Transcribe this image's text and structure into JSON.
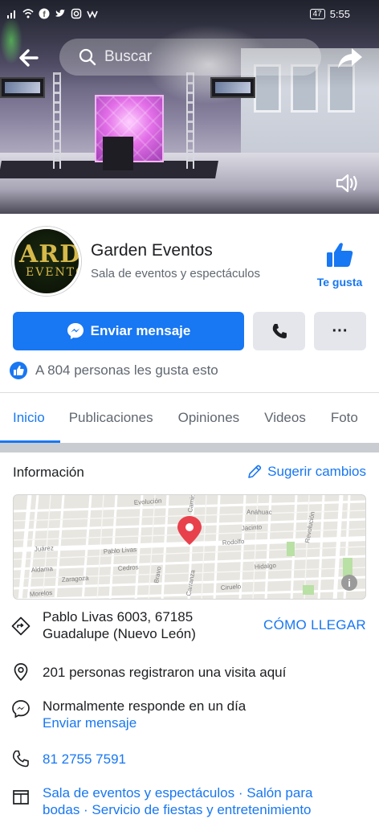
{
  "status_bar": {
    "battery": "47",
    "time": "5:55"
  },
  "search": {
    "placeholder": "Buscar"
  },
  "page": {
    "avatar_text_top": "ARDE",
    "avatar_text_bottom": "EVENTO",
    "name": "Garden Eventos",
    "category": "Sala de eventos y espectáculos",
    "like_label": "Te gusta"
  },
  "actions": {
    "message_label": "Enviar mensaje",
    "more_label": "···"
  },
  "likes_text": "A 804 personas les gusta esto",
  "tabs": [
    {
      "label": "Inicio"
    },
    {
      "label": "Publicaciones"
    },
    {
      "label": "Opiniones"
    },
    {
      "label": "Videos"
    },
    {
      "label": "Foto"
    }
  ],
  "info": {
    "title": "Información",
    "suggest_label": "Sugerir cambios",
    "address_line1": "Pablo Livas 6003, 67185",
    "address_line2": "Guadalupe (Nuevo León)",
    "directions_label": "CÓMO LLEGAR",
    "visits_text": "201 personas registraron una visita aquí",
    "response_text": "Normalmente responde en un día",
    "response_link": "Enviar mensaje",
    "phone": "81 2755 7591",
    "categories_line1": "Sala de eventos y espectáculos · Salón para",
    "categories_line2": "bodas · Servicio de fiestas y entretenimiento"
  },
  "map": {
    "street_labels": [
      "Pablo Livas",
      "Evolución",
      "Camino",
      "Anáhuac",
      "Rodolfo",
      "Aldama",
      "Juárez",
      "Morelos",
      "Cedros",
      "Jacinto",
      "Ciruelo",
      "Revolución",
      "Zaragoza",
      "Bravo",
      "Hidalgo",
      "Carranza"
    ]
  },
  "colors": {
    "accent": "#1877f2",
    "map_pin": "#e8414c"
  }
}
